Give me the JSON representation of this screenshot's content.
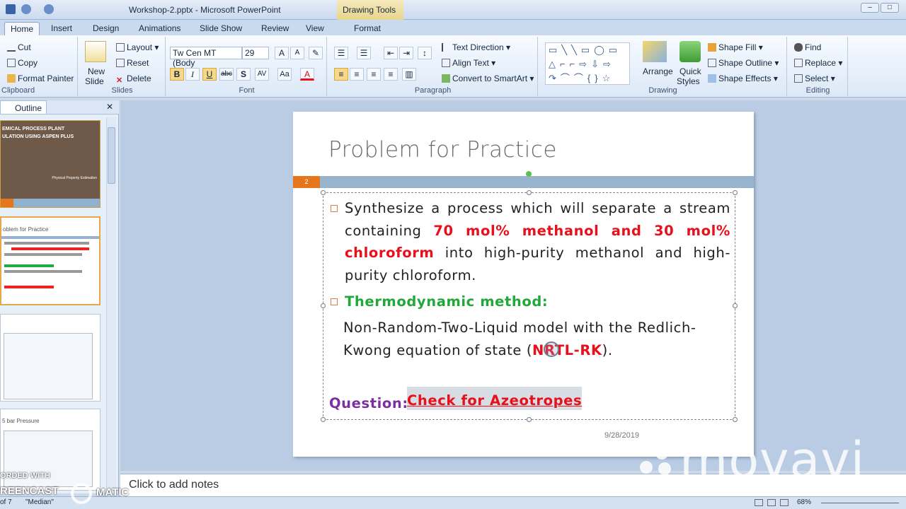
{
  "window": {
    "title": "Workshop-2.pptx - Microsoft PowerPoint",
    "context_tab": "Drawing Tools"
  },
  "tabs": [
    {
      "label": "Home"
    },
    {
      "label": "Insert"
    },
    {
      "label": "Design"
    },
    {
      "label": "Animations"
    },
    {
      "label": "Slide Show"
    },
    {
      "label": "Review"
    },
    {
      "label": "View"
    },
    {
      "label": "Format"
    }
  ],
  "ribbon": {
    "clipboard": {
      "label": "Clipboard",
      "cut": "Cut",
      "copy": "Copy",
      "format_painter": "Format Painter"
    },
    "slides": {
      "label": "Slides",
      "new_slide": "New",
      "new_slide2": "Slide",
      "layout": "Layout",
      "reset": "Reset",
      "delete": "Delete"
    },
    "font": {
      "label": "Font",
      "family": "Tw Cen MT (Body",
      "size": "29"
    },
    "paragraph": {
      "label": "Paragraph",
      "text_direction": "Text Direction",
      "align_text": "Align Text",
      "convert_smartart": "Convert to SmartArt"
    },
    "drawing": {
      "label": "Drawing",
      "arrange": "Arrange",
      "quick": "Quick",
      "styles": "Styles",
      "shape_fill": "Shape Fill",
      "shape_outline": "Shape Outline",
      "shape_effects": "Shape Effects"
    },
    "editing": {
      "label": "Editing",
      "find": "Find",
      "replace": "Replace",
      "select": "Select"
    }
  },
  "left_pane": {
    "tab": "Outline",
    "thumb1": {
      "line1": "EMICAL PROCESS PLANT",
      "line2": "ULATION USING ASPEN PLUS",
      "sub": "Physical Property Estimation"
    },
    "thumb2": {
      "title": "oblem for Practice"
    },
    "thumb4": {
      "title": "5 bar Pressure"
    }
  },
  "slide": {
    "number": "2",
    "title": "Problem for Practice",
    "p1": {
      "t1": "Synthesize a process which will separate a stream",
      "t2": "containing ",
      "red": "70 mol% methanol and 30 mol%",
      "red2": "chloroform",
      "t3": " into high-purity methanol and high-",
      "t4": "purity chloroform."
    },
    "method_label": "Thermodynamic method:",
    "method": {
      "t1": "Non-Random-Two-Liquid model with the Redlich-",
      "t2": "Kwong equation of state (",
      "red": "NRTL-RK",
      "t3": ")."
    },
    "question_label": "Question:",
    "question_link": "Check for Azeotropes",
    "date": "9/28/2019"
  },
  "notes": "Click to add notes",
  "watermark": {
    "movavi": "movavi",
    "recorded": "ORDED WITH",
    "screencast": "REENCAST",
    "matic": "MATIC"
  },
  "status": {
    "slide": "of 7",
    "theme": "\"Median\"",
    "zoom": "68%"
  }
}
